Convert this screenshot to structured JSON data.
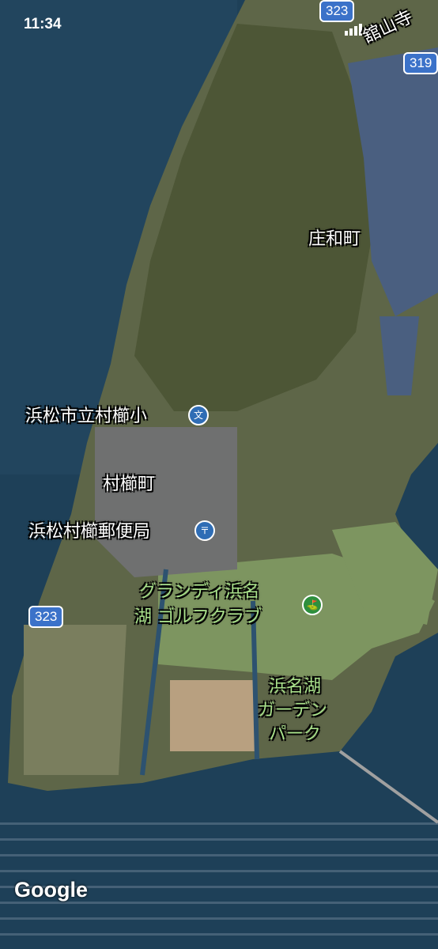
{
  "status_bar": {
    "time": "11:34"
  },
  "map": {
    "place_labels": {
      "shouwa": "庄和町",
      "school": "浜松市立村櫛小",
      "murakushi": "村櫛町",
      "post_office": "浜松村櫛郵便局",
      "golf_line1": "グランディ浜名",
      "golf_line2": "湖 ゴルフクラブ",
      "garden_line1": "浜名湖",
      "garden_line2": "ガーデン",
      "garden_line3": "パーク",
      "top_right_partial": "舘山寺"
    },
    "road_shields": {
      "r323_top": "323",
      "r319": "319",
      "r323_left": "323"
    },
    "pin_glyphs": {
      "school": "文",
      "post_office": "〒",
      "golf": "⛳"
    },
    "attribution": "Google",
    "colors": {
      "water": "#1e4058",
      "land": "#5e6648",
      "forest": "#4d5636",
      "solar": "#4a5f80",
      "golf": "#7d9560",
      "shield": "#3b72c9"
    }
  }
}
